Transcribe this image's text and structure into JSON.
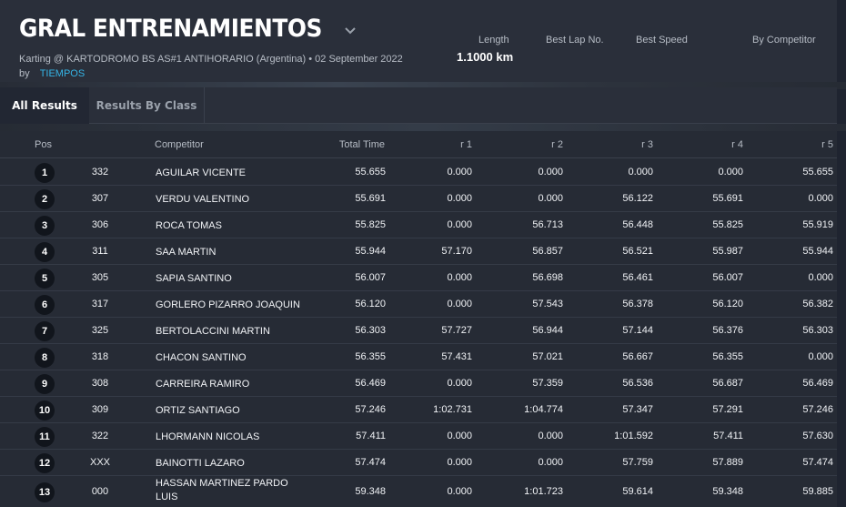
{
  "header": {
    "title": "GRAL ENTRENAMIENTOS",
    "subtitle": "Karting @ KARTODROMO BS AS#1 ANTIHORARIO (Argentina) • 02 September 2022",
    "by_label": "by",
    "by_link": "TIEMPOS",
    "stats": {
      "length_label": "Length",
      "length_value": "1.1000 km",
      "best_lap_label": "Best Lap No.",
      "best_speed_label": "Best Speed",
      "by_competitor_label": "By Competitor"
    }
  },
  "tabs": [
    {
      "label": "All Results",
      "active": true
    },
    {
      "label": "Results By Class",
      "active": false
    }
  ],
  "table": {
    "headers": [
      "Pos",
      "Competitor",
      "Total Time",
      "r 1",
      "r 2",
      "r 3",
      "r 4",
      "r 5"
    ],
    "rows": [
      {
        "pos": "1",
        "no": "332",
        "name": "AGUILAR VICENTE",
        "total": "55.655",
        "r1": "0.000",
        "r2": "0.000",
        "r3": "0.000",
        "r4": "0.000",
        "r5": "55.655"
      },
      {
        "pos": "2",
        "no": "307",
        "name": "VERDU VALENTINO",
        "total": "55.691",
        "r1": "0.000",
        "r2": "0.000",
        "r3": "56.122",
        "r4": "55.691",
        "r5": "0.000"
      },
      {
        "pos": "3",
        "no": "306",
        "name": "ROCA TOMAS",
        "total": "55.825",
        "r1": "0.000",
        "r2": "56.713",
        "r3": "56.448",
        "r4": "55.825",
        "r5": "55.919"
      },
      {
        "pos": "4",
        "no": "311",
        "name": "SAA MARTIN",
        "total": "55.944",
        "r1": "57.170",
        "r2": "56.857",
        "r3": "56.521",
        "r4": "55.987",
        "r5": "55.944"
      },
      {
        "pos": "5",
        "no": "305",
        "name": "SAPIA SANTINO",
        "total": "56.007",
        "r1": "0.000",
        "r2": "56.698",
        "r3": "56.461",
        "r4": "56.007",
        "r5": "0.000"
      },
      {
        "pos": "6",
        "no": "317",
        "name": "GORLERO PIZARRO JOAQUIN",
        "total": "56.120",
        "r1": "0.000",
        "r2": "57.543",
        "r3": "56.378",
        "r4": "56.120",
        "r5": "56.382"
      },
      {
        "pos": "7",
        "no": "325",
        "name": "BERTOLACCINI MARTIN",
        "total": "56.303",
        "r1": "57.727",
        "r2": "56.944",
        "r3": "57.144",
        "r4": "56.376",
        "r5": "56.303"
      },
      {
        "pos": "8",
        "no": "318",
        "name": "CHACON SANTINO",
        "total": "56.355",
        "r1": "57.431",
        "r2": "57.021",
        "r3": "56.667",
        "r4": "56.355",
        "r5": "0.000"
      },
      {
        "pos": "9",
        "no": "308",
        "name": "CARREIRA RAMIRO",
        "total": "56.469",
        "r1": "0.000",
        "r2": "57.359",
        "r3": "56.536",
        "r4": "56.687",
        "r5": "56.469"
      },
      {
        "pos": "10",
        "no": "309",
        "name": "ORTIZ SANTIAGO",
        "total": "57.246",
        "r1": "1:02.731",
        "r2": "1:04.774",
        "r3": "57.347",
        "r4": "57.291",
        "r5": "57.246"
      },
      {
        "pos": "11",
        "no": "322",
        "name": "LHORMANN NICOLAS",
        "total": "57.411",
        "r1": "0.000",
        "r2": "0.000",
        "r3": "1:01.592",
        "r4": "57.411",
        "r5": "57.630"
      },
      {
        "pos": "12",
        "no": "XXX",
        "name": "BAINOTTI LAZARO",
        "total": "57.474",
        "r1": "0.000",
        "r2": "0.000",
        "r3": "57.759",
        "r4": "57.889",
        "r5": "57.474"
      },
      {
        "pos": "13",
        "no": "000",
        "name": "HASSAN MARTINEZ PARDO LUIS",
        "total": "59.348",
        "r1": "0.000",
        "r2": "1:01.723",
        "r3": "59.614",
        "r4": "59.348",
        "r5": "59.885"
      }
    ]
  }
}
